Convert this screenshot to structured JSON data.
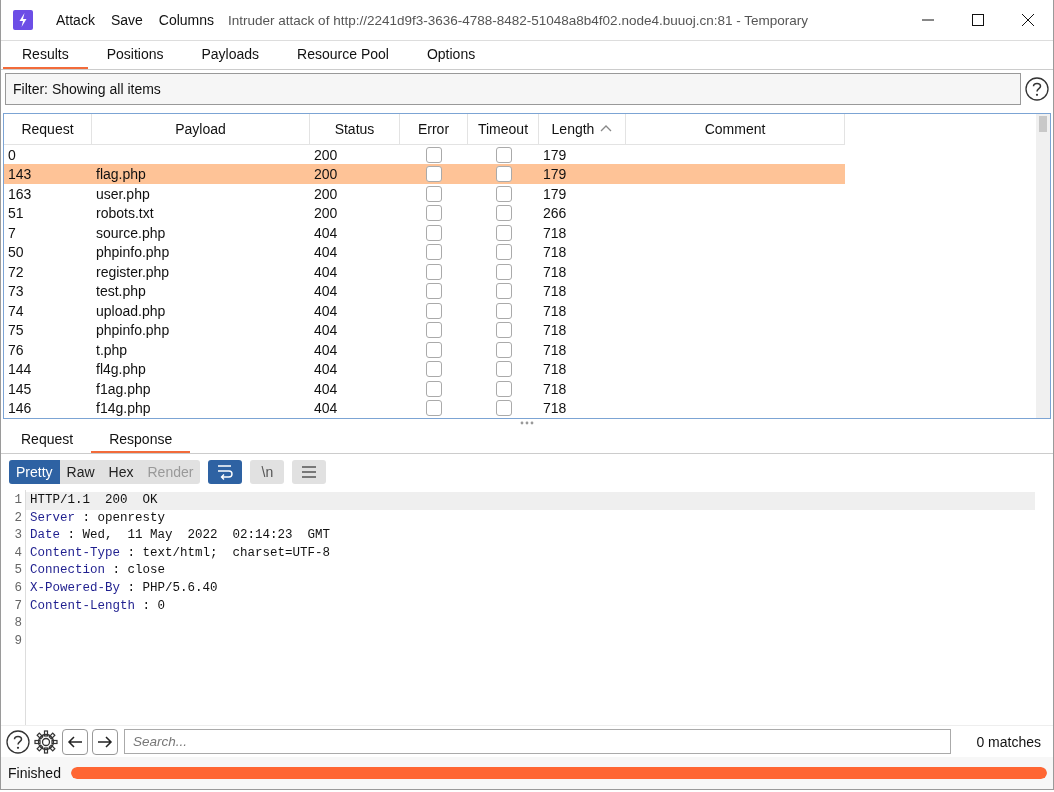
{
  "window": {
    "title": "Intruder attack of http://2241d9f3-3636-4788-8482-51048a8b4f02.node4.buuoj.cn:81 - Temporary",
    "menu": [
      "Attack",
      "Save",
      "Columns"
    ]
  },
  "tabs": [
    {
      "label": "Results",
      "selected": true
    },
    {
      "label": "Positions",
      "selected": false
    },
    {
      "label": "Payloads",
      "selected": false
    },
    {
      "label": "Resource Pool",
      "selected": false
    },
    {
      "label": "Options",
      "selected": false
    }
  ],
  "filter": {
    "text": "Filter: Showing all items"
  },
  "results": {
    "columns": [
      {
        "label": "Request",
        "sorted": false
      },
      {
        "label": "Payload",
        "sorted": false
      },
      {
        "label": "Status",
        "sorted": false
      },
      {
        "label": "Error",
        "sorted": false
      },
      {
        "label": "Timeout",
        "sorted": false
      },
      {
        "label": "Length",
        "sorted": true
      },
      {
        "label": "Comment",
        "sorted": false
      }
    ],
    "rows": [
      {
        "request": "0",
        "status": "200",
        "error": false,
        "timeout": false,
        "length": "179",
        "selected": false
      },
      {
        "request": "143",
        "payload": "flag.php",
        "status": "200",
        "error": false,
        "timeout": false,
        "length": "179",
        "selected": true
      },
      {
        "request": "163",
        "payload": "user.php",
        "status": "200",
        "error": false,
        "timeout": false,
        "length": "179",
        "selected": false
      },
      {
        "request": "51",
        "payload": "robots.txt",
        "status": "200",
        "error": false,
        "timeout": false,
        "length": "266",
        "selected": false
      },
      {
        "request": "7",
        "payload": "source.php",
        "status": "404",
        "error": false,
        "timeout": false,
        "length": "718",
        "selected": false
      },
      {
        "request": "50",
        "payload": "phpinfo.php",
        "status": "404",
        "error": false,
        "timeout": false,
        "length": "718",
        "selected": false
      },
      {
        "request": "72",
        "payload": "register.php",
        "status": "404",
        "error": false,
        "timeout": false,
        "length": "718",
        "selected": false
      },
      {
        "request": "73",
        "payload": "test.php",
        "status": "404",
        "error": false,
        "timeout": false,
        "length": "718",
        "selected": false
      },
      {
        "request": "74",
        "payload": "upload.php",
        "status": "404",
        "error": false,
        "timeout": false,
        "length": "718",
        "selected": false
      },
      {
        "request": "75",
        "payload": "phpinfo.php",
        "status": "404",
        "error": false,
        "timeout": false,
        "length": "718",
        "selected": false
      },
      {
        "request": "76",
        "payload": "t.php",
        "status": "404",
        "error": false,
        "timeout": false,
        "length": "718",
        "selected": false
      },
      {
        "request": "144",
        "payload": "fl4g.php",
        "status": "404",
        "error": false,
        "timeout": false,
        "length": "718",
        "selected": false
      },
      {
        "request": "145",
        "payload": "f1ag.php",
        "status": "404",
        "error": false,
        "timeout": false,
        "length": "718",
        "selected": false
      },
      {
        "request": "146",
        "payload": "f14g.php",
        "status": "404",
        "error": false,
        "timeout": false,
        "length": "718",
        "selected": false
      }
    ]
  },
  "message_tabs": [
    {
      "label": "Request",
      "selected": false
    },
    {
      "label": "Response",
      "selected": true
    }
  ],
  "view_modes": [
    {
      "label": "Pretty",
      "selected": true,
      "disabled": false
    },
    {
      "label": "Raw",
      "selected": false,
      "disabled": false
    },
    {
      "label": "Hex",
      "selected": false,
      "disabled": false
    },
    {
      "label": "Render",
      "selected": false,
      "disabled": true
    }
  ],
  "toolbar": {
    "wrap_on": true,
    "newline_label": "\\n",
    "newline_on": false,
    "menu_on": false
  },
  "editor": {
    "lines": [
      {
        "number": "1",
        "kind": "status",
        "text": "HTTP/1.1  200  OK"
      },
      {
        "number": "2",
        "kind": "header",
        "key": "Server",
        "value": ": openresty"
      },
      {
        "number": "3",
        "kind": "header",
        "key": "Date",
        "value": ": Wed,  11 May  2022  02:14:23  GMT"
      },
      {
        "number": "4",
        "kind": "header",
        "key": "Content-Type",
        "value": ": text/html;  charset=UTF-8"
      },
      {
        "number": "5",
        "kind": "header",
        "key": "Connection",
        "value": ": close"
      },
      {
        "number": "6",
        "kind": "header",
        "key": "X-Powered-By",
        "value": ": PHP/5.6.40"
      },
      {
        "number": "7",
        "kind": "header",
        "key": "Content-Length",
        "value": ": 0"
      },
      {
        "number": "8",
        "kind": "blank"
      },
      {
        "number": "9",
        "kind": "blank"
      }
    ]
  },
  "search": {
    "placeholder": "Search...",
    "matches": "0 matches"
  },
  "status_bar": {
    "text": "Finished",
    "level": 1
  }
}
